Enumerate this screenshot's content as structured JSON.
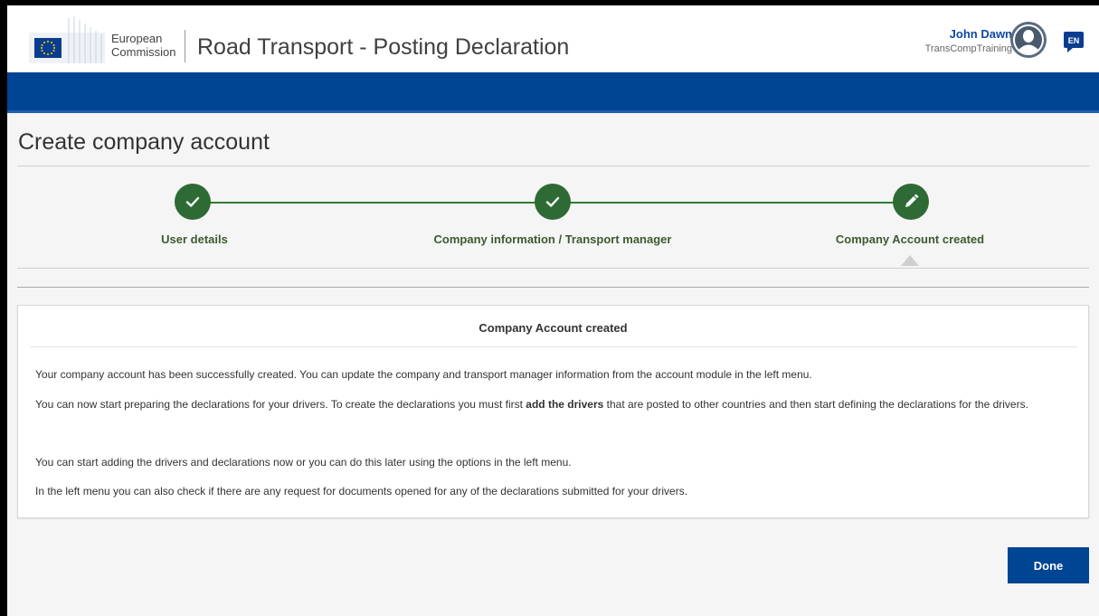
{
  "header": {
    "org_line1": "European",
    "org_line2": "Commission",
    "app_title": "Road Transport - Posting Declaration",
    "user_name": "John Dawn",
    "user_org": "TransCompTraining",
    "language": "EN",
    "icons": {
      "logo": "eu-flag-logo",
      "avatar": "user-avatar-icon",
      "language": "language-icon"
    }
  },
  "page": {
    "title": "Create company account"
  },
  "stepper": {
    "steps": [
      {
        "label": "User details",
        "status": "completed",
        "icon": "check-icon"
      },
      {
        "label": "Company information / Transport manager",
        "status": "completed",
        "icon": "check-icon"
      },
      {
        "label": "Company Account created",
        "status": "current",
        "icon": "pencil-icon"
      }
    ],
    "color": "#2e6b34"
  },
  "panel": {
    "title": "Company Account created",
    "p1": "Your company account has been successfully created. You can update the company and transport manager information from the account module in the left menu.",
    "p2_before": "You can now start preparing the declarations for your drivers. To create the declarations you must first ",
    "p2_bold": "add the drivers",
    "p2_after": " that are posted to other countries and then start defining the declarations for the drivers.",
    "p3": "You can start adding the drivers and declarations now or you can do this later using the options in the left menu.",
    "p4": "In the left menu you can also check if there are any request for documents opened for any of the declarations submitted for your drivers."
  },
  "actions": {
    "done_label": "Done"
  },
  "colors": {
    "brand_blue": "#004494",
    "success_green": "#2e6b34",
    "user_name": "#0e47a1"
  }
}
